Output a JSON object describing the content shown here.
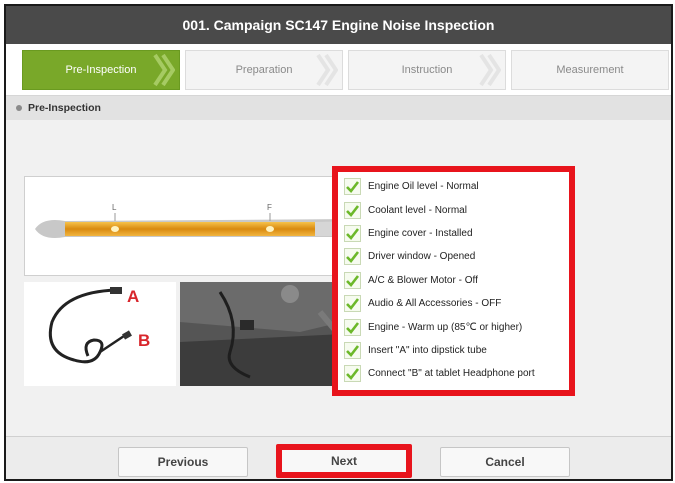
{
  "window": {
    "title": "001. Campaign SC147 Engine Noise Inspection"
  },
  "steps": [
    {
      "label": "Pre-Inspection",
      "active": true
    },
    {
      "label": "Preparation",
      "active": false
    },
    {
      "label": "Instruction",
      "active": false
    },
    {
      "label": "Measurement",
      "active": false
    }
  ],
  "section": {
    "title": "Pre-Inspection"
  },
  "images": {
    "dipstick": {
      "mark_low": "L",
      "mark_full": "F"
    },
    "cable": {
      "label_a": "A",
      "label_b": "B"
    }
  },
  "checklist": [
    "Engine Oil level - Normal",
    "Coolant level - Normal",
    "Engine cover - Installed",
    "Driver window - Opened",
    "A/C & Blower Motor - Off",
    "Audio & All Accessories - OFF",
    "Engine - Warm up (85℃ or higher)",
    "Insert \"A\" into dipstick tube",
    "Connect \"B\" at tablet Headphone port"
  ],
  "buttons": {
    "previous": "Previous",
    "next": "Next",
    "cancel": "Cancel"
  },
  "colors": {
    "active_step": "#79a829",
    "highlight": "#e8141c",
    "check": "#6cb82a"
  },
  "icons": {
    "check": "checkmark-icon",
    "chevron": "chevron-right-icon",
    "bullet": "bullet-icon"
  }
}
